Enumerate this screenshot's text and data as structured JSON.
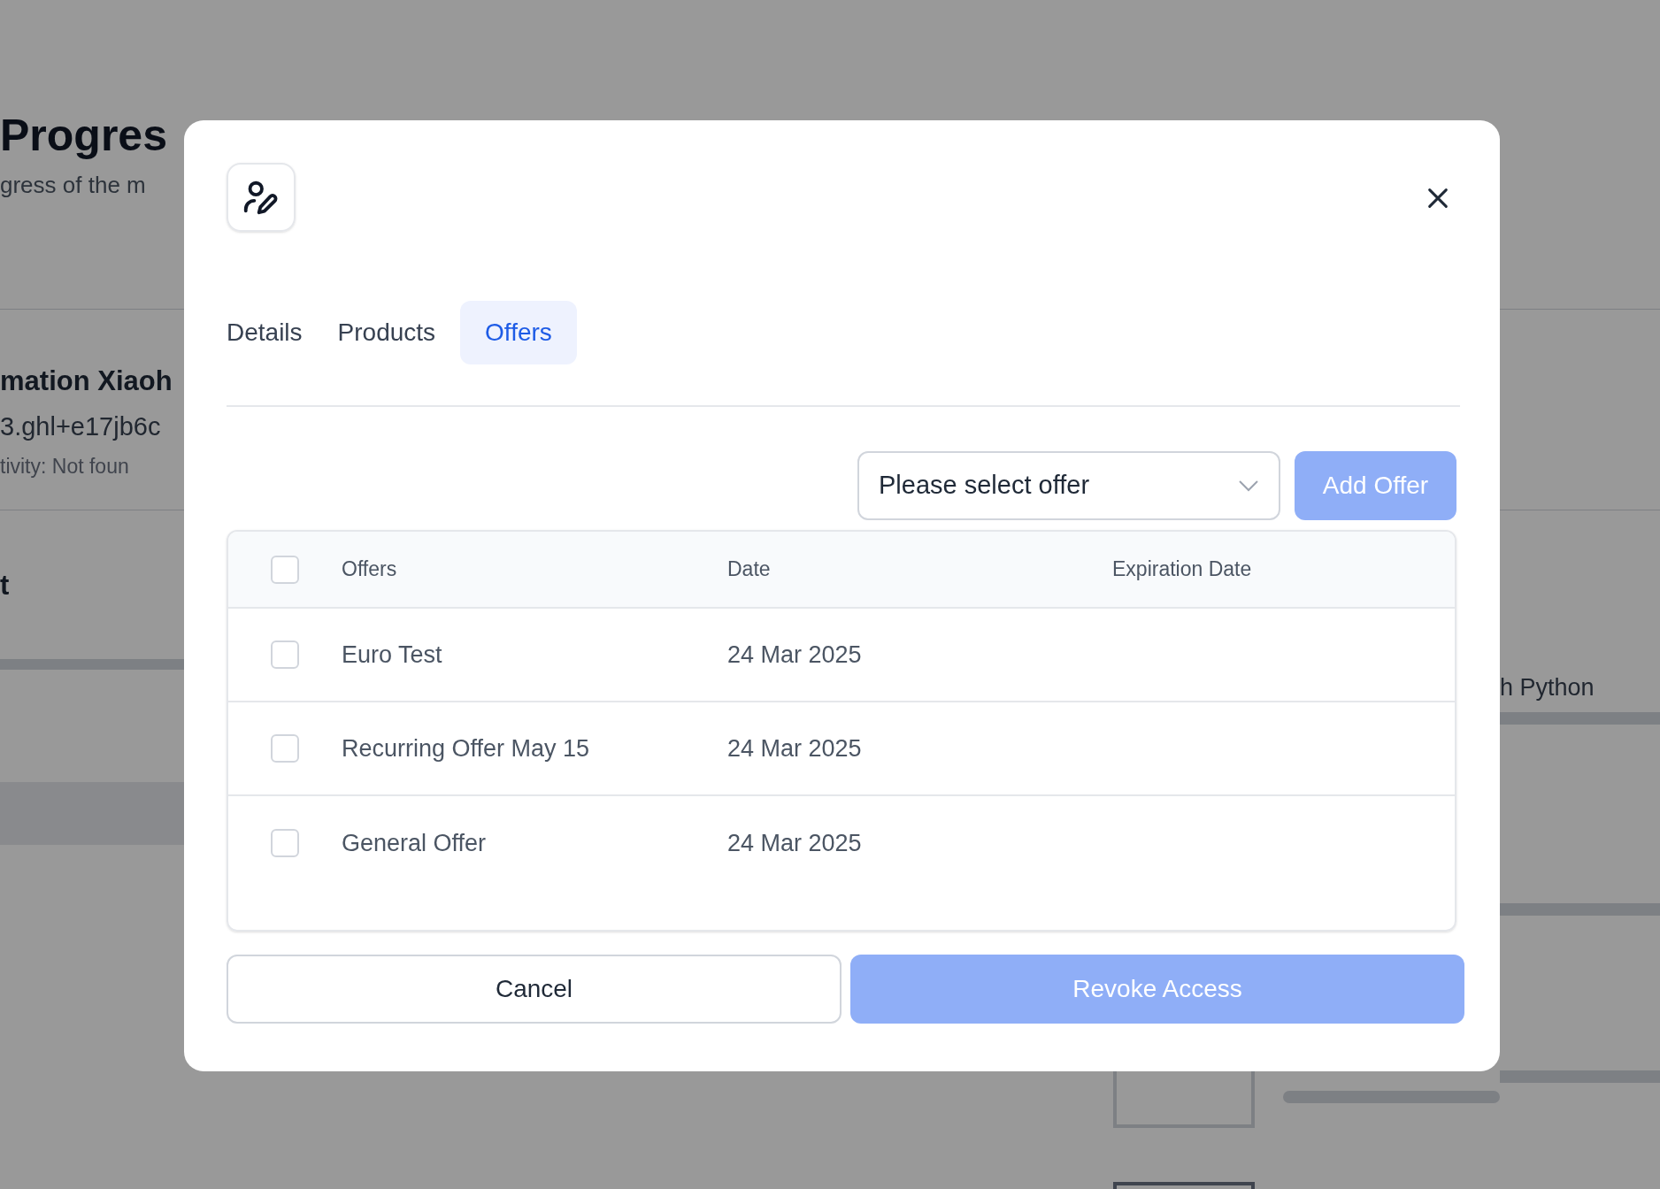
{
  "background": {
    "title": "Progres",
    "subtitle": "gress of the m",
    "profile": {
      "name": "mation Xiaoh",
      "email": "3.ghl+e17jb6c",
      "activity": "tivity: Not foun"
    },
    "section": "t",
    "course": "h Python"
  },
  "modal": {
    "tabs": [
      {
        "label": "Details",
        "selected": false
      },
      {
        "label": "Products",
        "selected": false
      },
      {
        "label": "Offers",
        "selected": true
      }
    ],
    "offer_select": {
      "placeholder": "Please select offer"
    },
    "add_button": {
      "label": "Add Offer",
      "disabled": true
    },
    "table": {
      "select_all": {
        "checked": false
      },
      "columns": [
        "Offers",
        "Date",
        "Expiration Date"
      ],
      "rows": [
        {
          "offer": "Euro Test",
          "date": "24 Mar 2025",
          "checked": false
        },
        {
          "offer": "Recurring Offer May 15",
          "date": "24 Mar 2025",
          "checked": false
        },
        {
          "offer": "General Offer",
          "date": "24 Mar 2025",
          "checked": false
        }
      ]
    },
    "cancel_button": {
      "label": "Cancel"
    },
    "revoke_button": {
      "label": "Revoke Access",
      "disabled": true
    }
  }
}
